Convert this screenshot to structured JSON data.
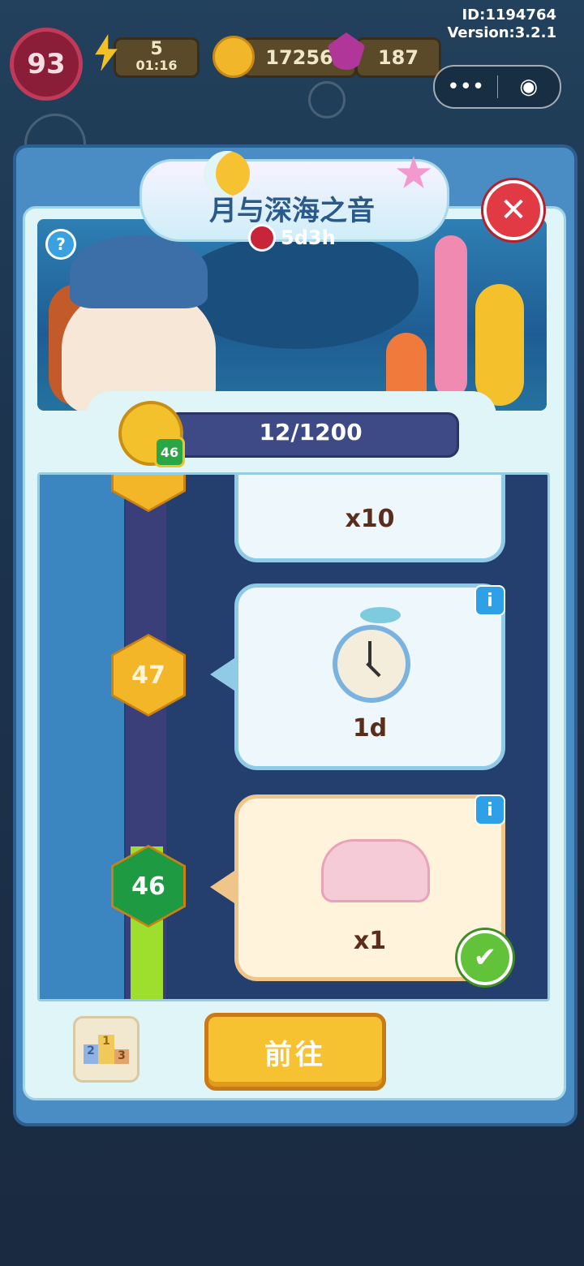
{
  "hud": {
    "id_text": "ID:1194764",
    "version_text": "Version:3.2.1",
    "player_level": "93",
    "energy": "5",
    "energy_timer": "01:16",
    "coins": "17256",
    "gems": "187"
  },
  "event": {
    "title": "月与深海之音",
    "time_left": "5d3h"
  },
  "progress": {
    "current_level": "46",
    "text": "12/1200"
  },
  "rewards": [
    {
      "level": "",
      "amount": "x10",
      "icon": "clover-icon",
      "claimed": false
    },
    {
      "level": "47",
      "amount": "1d",
      "icon": "stopwatch-icon",
      "claimed": false
    },
    {
      "level": "46",
      "amount": "x1",
      "icon": "sofa-icon",
      "claimed": true
    }
  ],
  "buttons": {
    "go_label": "前往"
  },
  "ranking": [
    "2",
    "1",
    "3"
  ],
  "colors": {
    "accent_gold": "#f6c232",
    "claimed_green": "#62c23a",
    "close_red": "#e23a45",
    "progress_bar": "#3e4a86"
  }
}
